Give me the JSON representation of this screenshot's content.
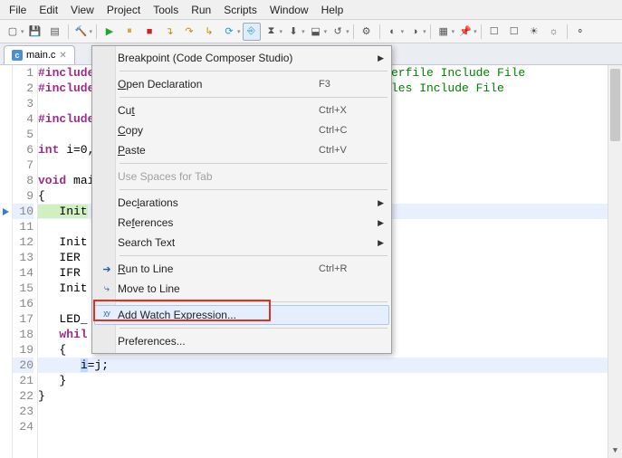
{
  "menubar": [
    "File",
    "Edit",
    "View",
    "Project",
    "Tools",
    "Run",
    "Scripts",
    "Window",
    "Help"
  ],
  "tab": {
    "name": "main.c"
  },
  "code": {
    "lines": [
      "#include",
      "#include",
      "",
      "#include",
      "",
      "int i=0,",
      "",
      "void mai",
      "{",
      "   Init",
      "",
      "   Init",
      "   IER ",
      "   IFR ",
      "   Init",
      "",
      "   LED_",
      "   whil",
      "   {",
      "      i=j;",
      "   }",
      "}",
      "",
      ""
    ],
    "comment_lines": [
      "erfile Include File",
      "les Include File"
    ]
  },
  "context_menu": {
    "breakpoint": "Breakpoint (Code Composer Studio)",
    "open_decl": {
      "pre": "",
      "u": "O",
      "post": "pen Declaration",
      "shortcut": "F3"
    },
    "cut": {
      "pre": "Cu",
      "u": "t",
      "post": "",
      "shortcut": "Ctrl+X"
    },
    "copy": {
      "pre": "",
      "u": "C",
      "post": "opy",
      "shortcut": "Ctrl+C"
    },
    "paste": {
      "pre": "",
      "u": "P",
      "post": "aste",
      "shortcut": "Ctrl+V"
    },
    "spaces": "Use Spaces for Tab",
    "decl": {
      "pre": "Dec",
      "u": "l",
      "post": "arations"
    },
    "refs": {
      "pre": "Re",
      "u": "f",
      "post": "erences"
    },
    "search": "Search Text",
    "run_to": {
      "pre": "",
      "u": "R",
      "post": "un to Line",
      "shortcut": "Ctrl+R"
    },
    "move_to": "Move to Line",
    "watch": "Add Watch Expression...",
    "prefs": "Preferences..."
  }
}
